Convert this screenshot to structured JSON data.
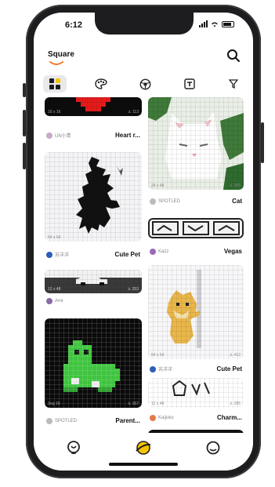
{
  "status": {
    "time": "6:12"
  },
  "header": {
    "title": "Square"
  },
  "tabs": [
    {
      "icon": "grid-icon",
      "active": true
    },
    {
      "icon": "palette-icon",
      "active": false
    },
    {
      "icon": "ball-icon",
      "active": false
    },
    {
      "icon": "frame-icon",
      "active": false
    },
    {
      "icon": "filter-icon",
      "active": false
    }
  ],
  "posts": {
    "heart": {
      "author": "UN小青",
      "title": "Heart r...",
      "size": "16 x 16",
      "likes": "113"
    },
    "cat": {
      "author": "SPOTLED",
      "title": "Cat",
      "size": "24 x 48",
      "likes": "105"
    },
    "cutepet1": {
      "author": "苏洋洋",
      "title": "Cute Pet",
      "size": "64 x 64"
    },
    "vegas": {
      "author": "Kazz",
      "title": "Vegas"
    },
    "car": {
      "author": "Ane",
      "size": "12 x 48",
      "likes": "253"
    },
    "doge": {
      "author": "苏洋洋",
      "title": "Cute Pet",
      "size": "64 x 64",
      "likes": "412"
    },
    "frog": {
      "author": "SPOTLED",
      "title": "Parent...",
      "size": "Zeg 16",
      "likes": "157"
    },
    "charm": {
      "author": "Kaijoko",
      "title": "Charm...",
      "size": "12 x 48",
      "likes": "285"
    }
  },
  "nav": [
    {
      "icon": "bulb-icon"
    },
    {
      "icon": "planet-icon",
      "active": true
    },
    {
      "icon": "profile-icon"
    }
  ],
  "colors": {
    "accent": "#f07a2a",
    "red": "#e31b1b",
    "green": "#3fc43f",
    "text": "#111111"
  }
}
